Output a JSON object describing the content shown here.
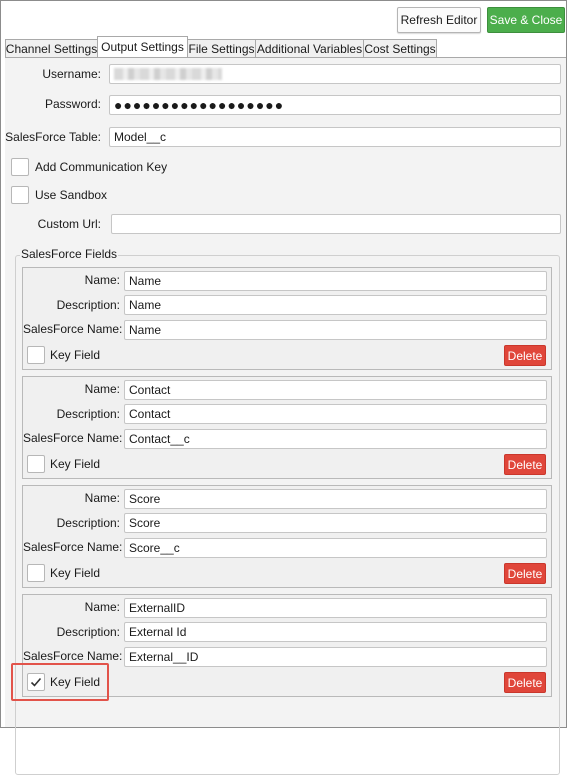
{
  "toolbar": {
    "refresh_label": "Refresh Editor",
    "save_close_label": "Save & Close"
  },
  "tabs": [
    {
      "label": "Channel Settings",
      "active": false
    },
    {
      "label": "Output Settings",
      "active": true
    },
    {
      "label": "File Settings",
      "active": false
    },
    {
      "label": "Additional Variables",
      "active": false
    },
    {
      "label": "Cost Settings",
      "active": false
    }
  ],
  "form": {
    "username_label": "Username:",
    "password_label": "Password:",
    "password_value": "●●●●●●●●●●●●●●●●●●",
    "table_label": "SalesForce Table:",
    "table_value": "Model__c",
    "add_comm_key_label": "Add Communication Key",
    "add_comm_key_checked": false,
    "use_sandbox_label": "Use Sandbox",
    "use_sandbox_checked": false,
    "custom_url_label": "Custom Url:",
    "custom_url_value": ""
  },
  "fields_group": {
    "title": "SalesForce Fields",
    "name_label": "Name:",
    "description_label": "Description:",
    "sf_name_label": "SalesForce Name:",
    "key_field_label": "Key Field",
    "delete_label": "Delete",
    "items": [
      {
        "name": "Name",
        "description": "Name",
        "sf_name": "Name",
        "key_field": false
      },
      {
        "name": "Contact",
        "description": "Contact",
        "sf_name": "Contact__c",
        "key_field": false
      },
      {
        "name": "Score",
        "description": "Score",
        "sf_name": "Score__c",
        "key_field": false
      },
      {
        "name": "ExternalID",
        "description": "External Id",
        "sf_name": "External__ID",
        "key_field": true
      }
    ]
  },
  "colors": {
    "save_button": "#4cae4c",
    "delete_button": "#e0463a",
    "highlight": "#e2534a"
  }
}
